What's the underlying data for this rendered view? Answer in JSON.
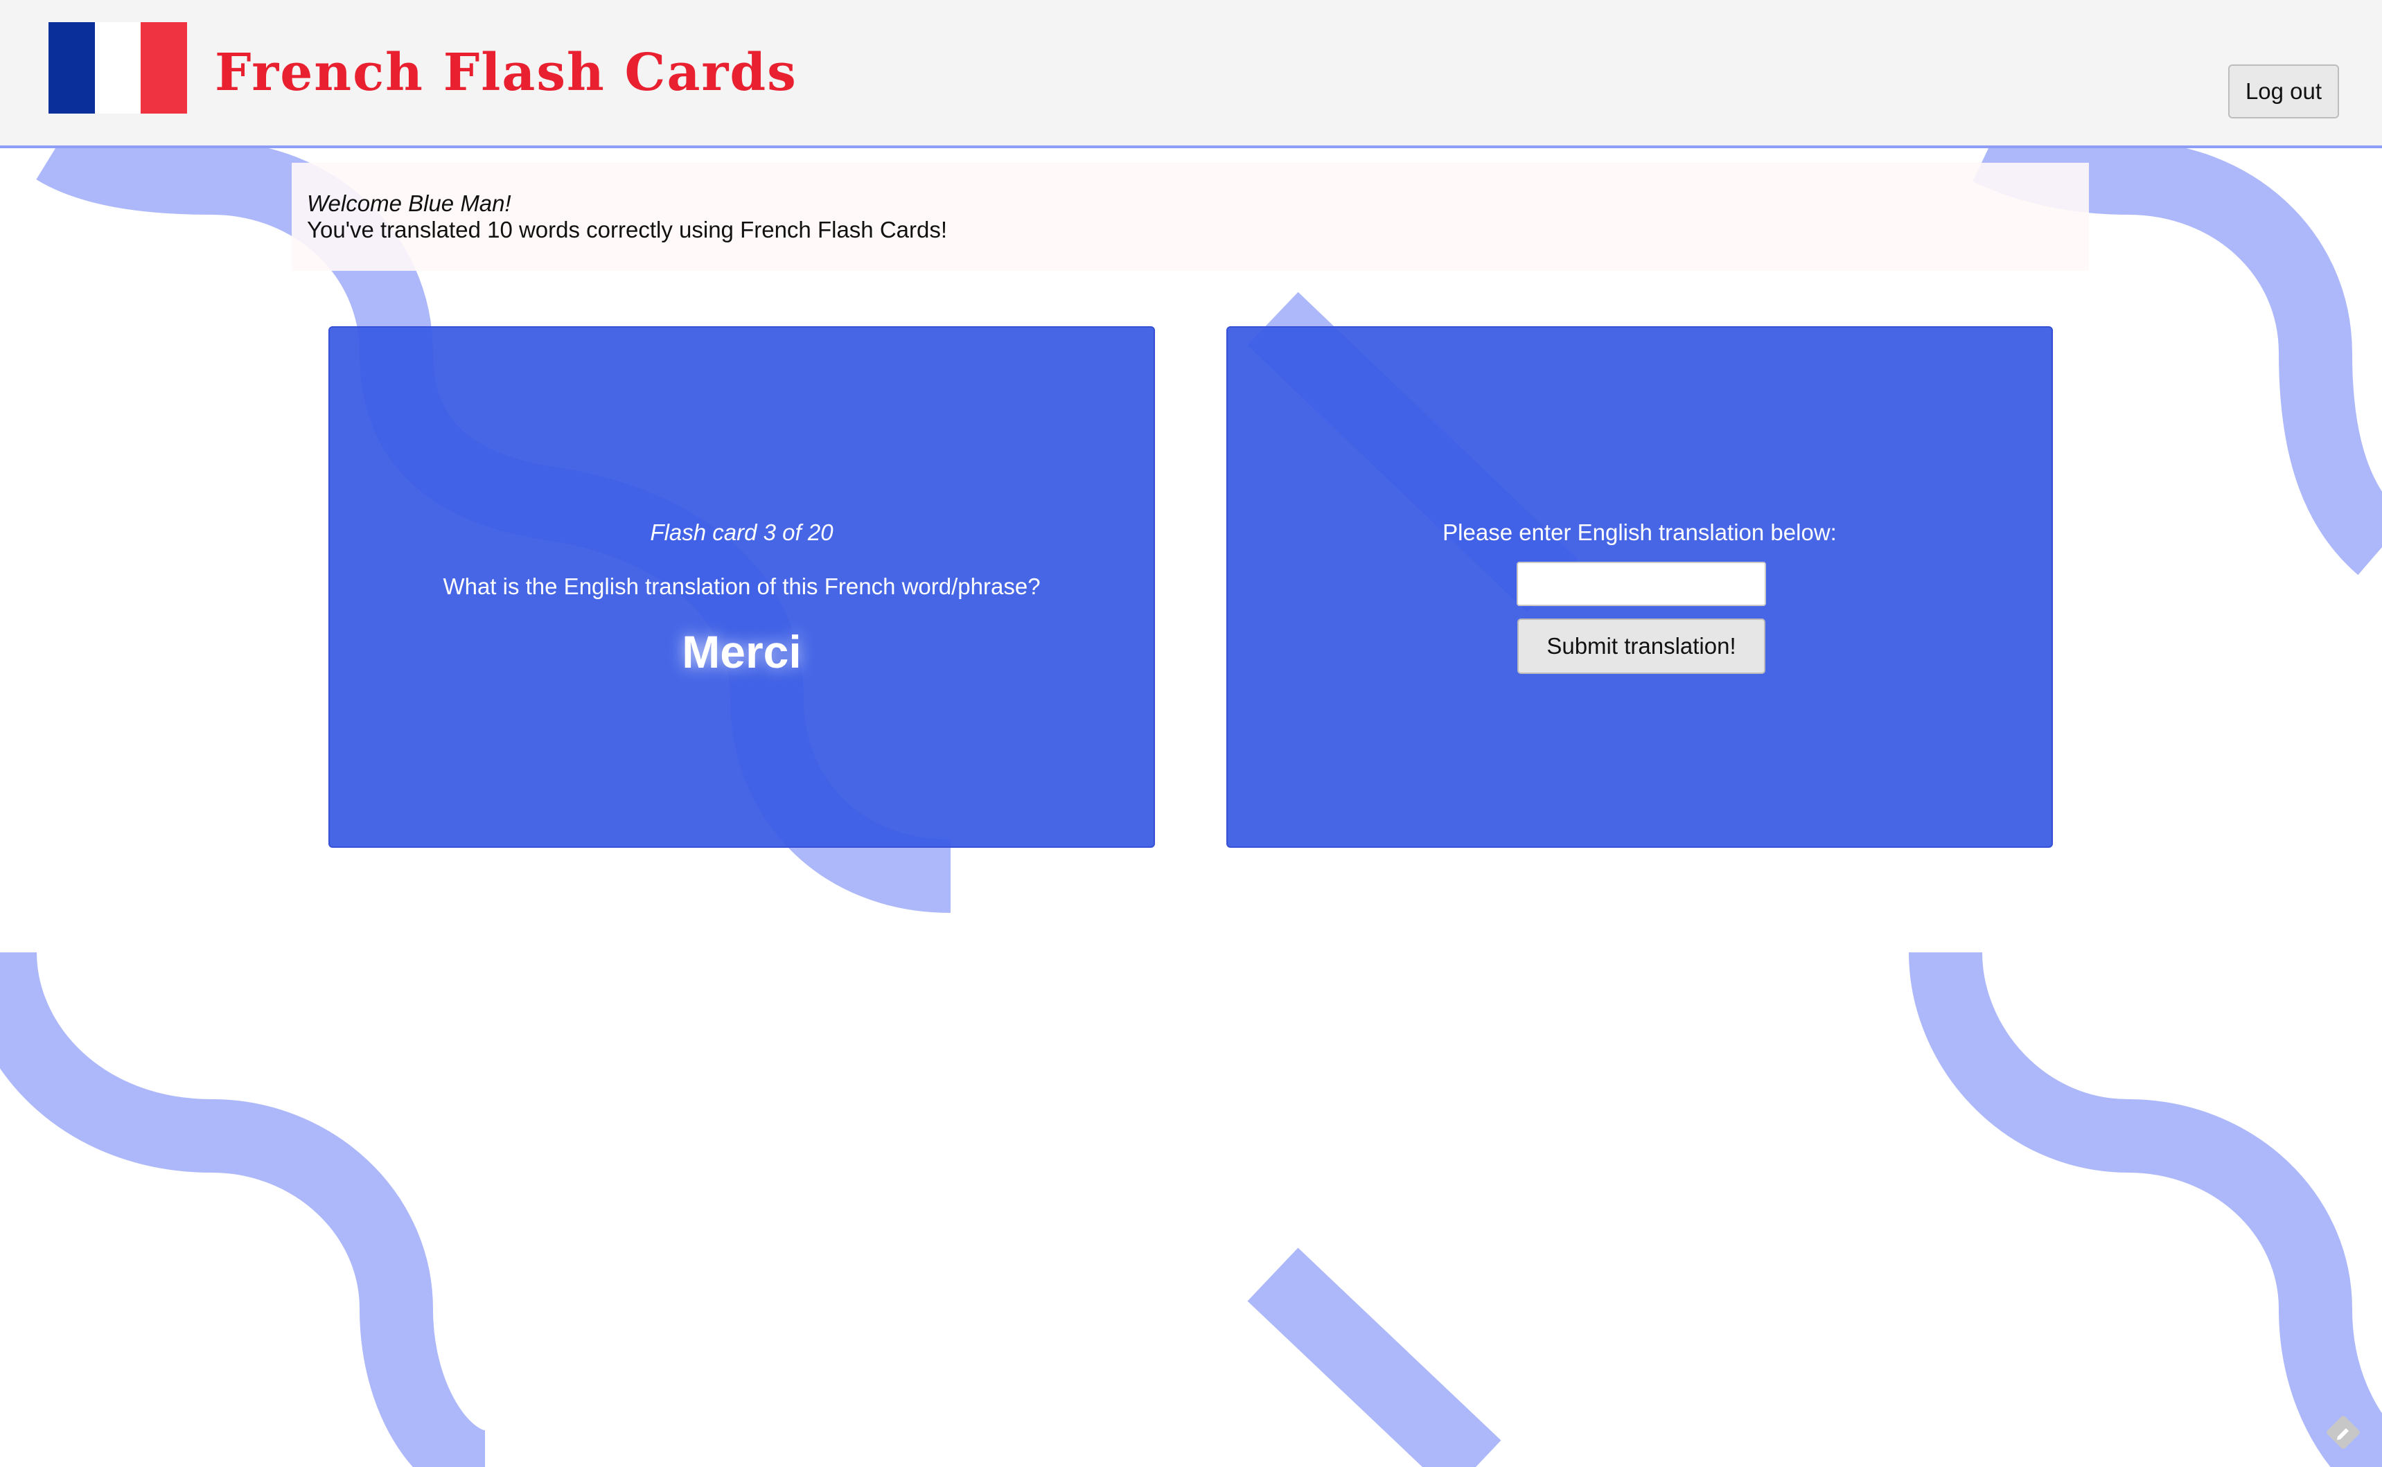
{
  "colors": {
    "header_bg": "#f4f4f4",
    "title_red": "#e8202f",
    "flag_blue": "#0a2f9b",
    "flag_white": "#ffffff",
    "flag_red": "#ef3340",
    "card_blue": "#3a5ce4",
    "pattern_blue": "#adb8fa"
  },
  "header": {
    "flag_icon": "french-flag-icon",
    "title": "French Flash Cards",
    "logout_label": "Log out"
  },
  "welcome": {
    "greeting": "Welcome Blue Man!",
    "stat": "You've translated 10 words correctly using French Flash Cards!"
  },
  "flash_card": {
    "counter": "Flash card 3 of 20",
    "question": "What is the English translation of this French word/phrase?",
    "word": "Merci"
  },
  "answer_card": {
    "prompt": "Please enter English translation below:",
    "input_value": "",
    "input_placeholder": "",
    "submit_label": "Submit translation!"
  },
  "corner_icon": "pencil-feedback-icon"
}
